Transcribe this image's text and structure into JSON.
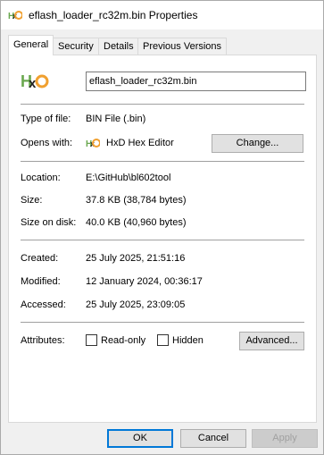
{
  "window": {
    "title": "eflash_loader_rc32m.bin Properties",
    "icon": "hxd-icon"
  },
  "tabs": [
    {
      "label": "General",
      "active": true
    },
    {
      "label": "Security",
      "active": false
    },
    {
      "label": "Details",
      "active": false
    },
    {
      "label": "Previous Versions",
      "active": false
    }
  ],
  "general": {
    "file_name": "eflash_loader_rc32m.bin",
    "type_label": "Type of file:",
    "type_value": "BIN File (.bin)",
    "opens_label": "Opens with:",
    "opens_value": "HxD Hex Editor",
    "change_button": "Change...",
    "location_label": "Location:",
    "location_value": "E:\\GitHub\\bl602tool",
    "size_label": "Size:",
    "size_value": "37.8 KB (38,784 bytes)",
    "size_on_disk_label": "Size on disk:",
    "size_on_disk_value": "40.0 KB (40,960 bytes)",
    "created_label": "Created:",
    "created_value": "25 July 2025, 21:51:16",
    "modified_label": "Modified:",
    "modified_value": "12 January 2024, 00:36:17",
    "accessed_label": "Accessed:",
    "accessed_value": "25 July 2025, 23:09:05",
    "attributes_label": "Attributes:",
    "readonly_label": "Read-only",
    "readonly_checked": false,
    "hidden_label": "Hidden",
    "hidden_checked": false,
    "advanced_button": "Advanced..."
  },
  "footer": {
    "ok": "OK",
    "cancel": "Cancel",
    "apply": "Apply"
  },
  "colors": {
    "accent": "#0078d7",
    "hxd_orange": "#f0a030",
    "hxd_green": "#6aa84f"
  }
}
